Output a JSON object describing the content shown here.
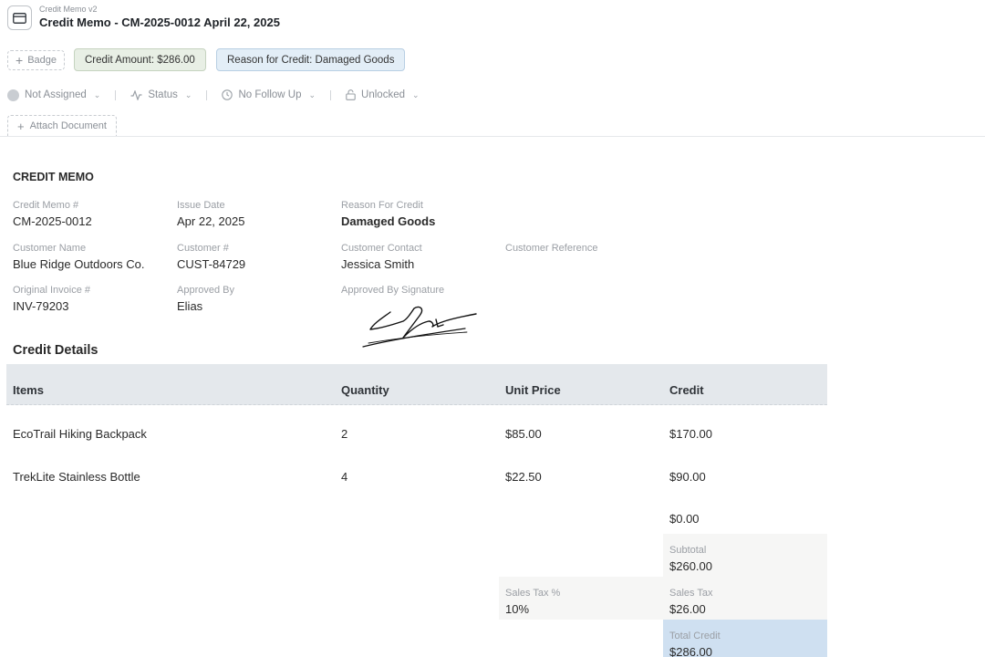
{
  "header": {
    "subtitle": "Credit Memo v2",
    "title": "Credit Memo - CM-2025-0012 April 22, 2025"
  },
  "badges": {
    "add_label": "Badge",
    "amount": "Credit Amount: $286.00",
    "reason": "Reason for Credit: Damaged Goods"
  },
  "toolbar": {
    "assignee": "Not Assigned",
    "status": "Status",
    "follow_up": "No Follow Up",
    "lock": "Unlocked",
    "attach": "Attach Document"
  },
  "document": {
    "heading": "CREDIT MEMO",
    "fields": {
      "memo_no": {
        "label": "Credit Memo #",
        "value": "CM-2025-0012"
      },
      "issue_date": {
        "label": "Issue Date",
        "value": "Apr 22, 2025"
      },
      "reason": {
        "label": "Reason For Credit",
        "value": "Damaged Goods"
      },
      "customer_name": {
        "label": "Customer Name",
        "value": "Blue Ridge Outdoors Co."
      },
      "customer_no": {
        "label": "Customer #",
        "value": "CUST-84729"
      },
      "customer_contact": {
        "label": "Customer Contact",
        "value": "Jessica Smith"
      },
      "customer_ref": {
        "label": "Customer Reference",
        "value": ""
      },
      "orig_invoice": {
        "label": "Original Invoice #",
        "value": "INV-79203"
      },
      "approved_by": {
        "label": "Approved By",
        "value": "Elias"
      },
      "approved_sig": {
        "label": "Approved By Signature"
      }
    },
    "details_title": "Credit Details",
    "table": {
      "headers": [
        "Items",
        "Quantity",
        "Unit Price",
        "Credit"
      ],
      "rows": [
        [
          "EcoTrail Hiking Backpack",
          "2",
          "$85.00",
          "$170.00"
        ],
        [
          "TrekLite Stainless Bottle",
          "4",
          "$22.50",
          "$90.00"
        ]
      ],
      "extra_credit": "$0.00"
    },
    "totals": {
      "subtotal": {
        "label": "Subtotal",
        "value": "$260.00"
      },
      "tax_rate": {
        "label": "Sales Tax %",
        "value": "10%"
      },
      "tax": {
        "label": "Sales Tax",
        "value": "$26.00"
      },
      "total": {
        "label": "Total Credit",
        "value": "$286.00"
      }
    }
  },
  "colors": {
    "amount_badge_bg": "#e8efe5",
    "reason_badge_bg": "#e3eef7",
    "table_header_bg": "#e4e8ec",
    "total_bg": "#cfe0f1"
  }
}
